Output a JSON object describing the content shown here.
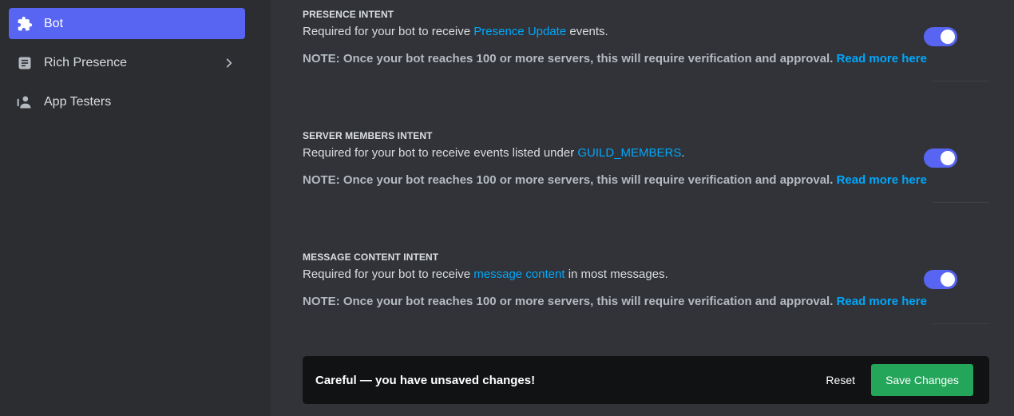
{
  "sidebar": {
    "items": [
      {
        "label": "Bot",
        "icon": "puzzle-icon",
        "active": true
      },
      {
        "label": "Rich Presence",
        "icon": "document-icon",
        "has_chevron": true
      },
      {
        "label": "App Testers",
        "icon": "user-testers-icon"
      }
    ]
  },
  "intents": [
    {
      "title": "PRESENCE INTENT",
      "desc_before": "Required for your bot to receive ",
      "desc_link": "Presence Update",
      "desc_after": " events.",
      "note": "NOTE: Once your bot reaches 100 or more servers, this will require verification and approval.",
      "note_link": "Read more here",
      "enabled": true
    },
    {
      "title": "SERVER MEMBERS INTENT",
      "desc_before": "Required for your bot to receive events listed under ",
      "desc_link": "GUILD_MEMBERS",
      "desc_after": ".",
      "note": "NOTE: Once your bot reaches 100 or more servers, this will require verification and approval.",
      "note_link": "Read more here",
      "enabled": true
    },
    {
      "title": "MESSAGE CONTENT INTENT",
      "desc_before": "Required for your bot to receive ",
      "desc_link": "message content",
      "desc_after": " in most messages.",
      "note": "NOTE: Once your bot reaches 100 or more servers, this will require verification and approval.",
      "note_link": "Read more here",
      "enabled": true
    }
  ],
  "notice": {
    "text": "Careful — you have unsaved changes!",
    "reset_label": "Reset",
    "save_label": "Save Changes"
  },
  "colors": {
    "accent": "#5865f2",
    "link": "#00a8fc",
    "save": "#23a55a",
    "sidebar_bg": "#2b2d31",
    "main_bg": "#313338"
  }
}
